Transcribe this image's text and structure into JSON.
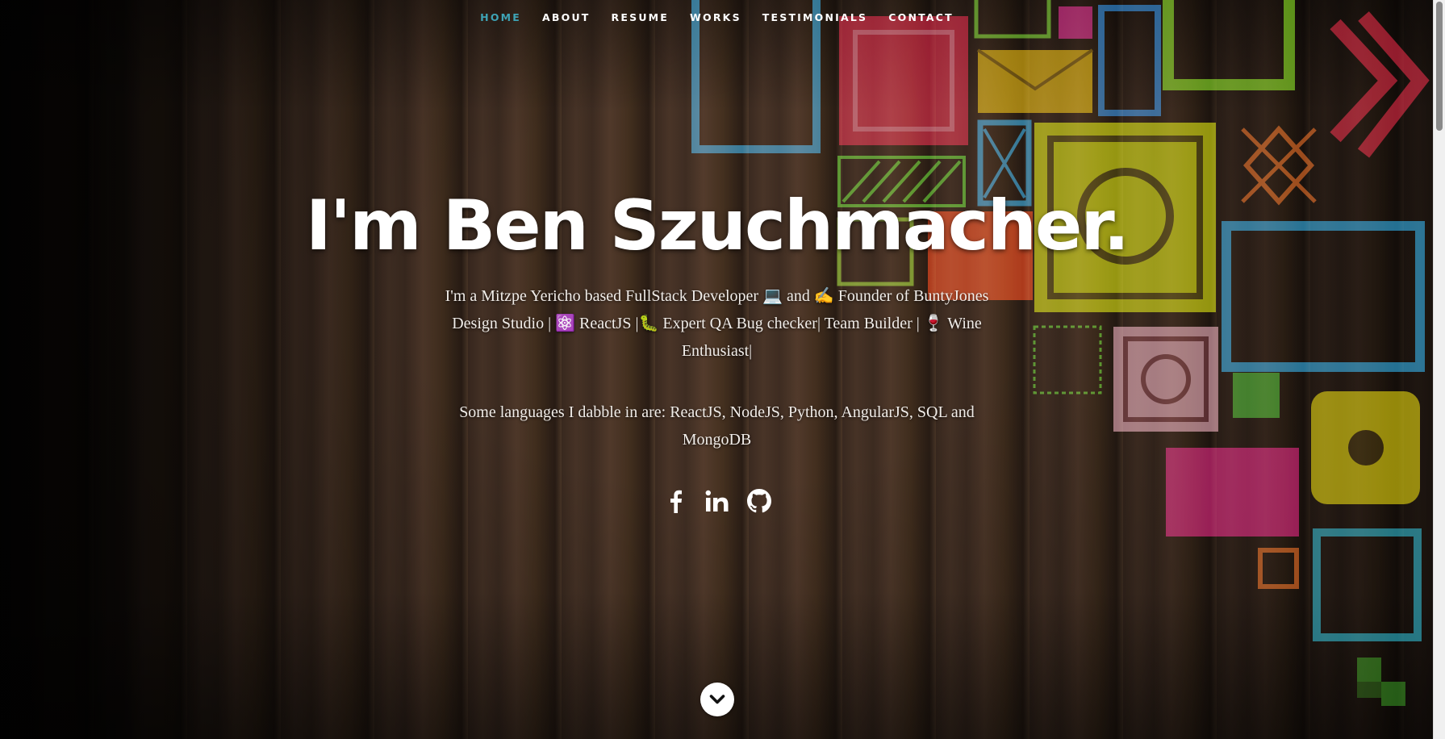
{
  "nav": {
    "items": [
      {
        "label": "HOME",
        "active": true
      },
      {
        "label": "ABOUT",
        "active": false
      },
      {
        "label": "RESUME",
        "active": false
      },
      {
        "label": "WORKS",
        "active": false
      },
      {
        "label": "TESTIMONIALS",
        "active": false
      },
      {
        "label": "CONTACT",
        "active": false
      }
    ],
    "active_color": "#3ea3b5"
  },
  "banner": {
    "headline": "I'm Ben Szuchmacher.",
    "intro": "I'm a Mitzpe Yericho based FullStack Developer 💻 and ✍️ Founder of BuntyJones Design Studio | ⚛️ ReactJS |🐛 Expert QA Bug checker| Team Builder | 🍷 Wine Enthusiast|",
    "languages": "Some languages I dabble in are: ReactJS, NodeJS, Python, AngularJS, SQL and MongoDB"
  },
  "social": [
    {
      "icon": "facebook-icon"
    },
    {
      "icon": "linkedin-icon"
    },
    {
      "icon": "github-icon"
    }
  ],
  "scroll_down": {
    "icon": "chevron-down-icon"
  }
}
